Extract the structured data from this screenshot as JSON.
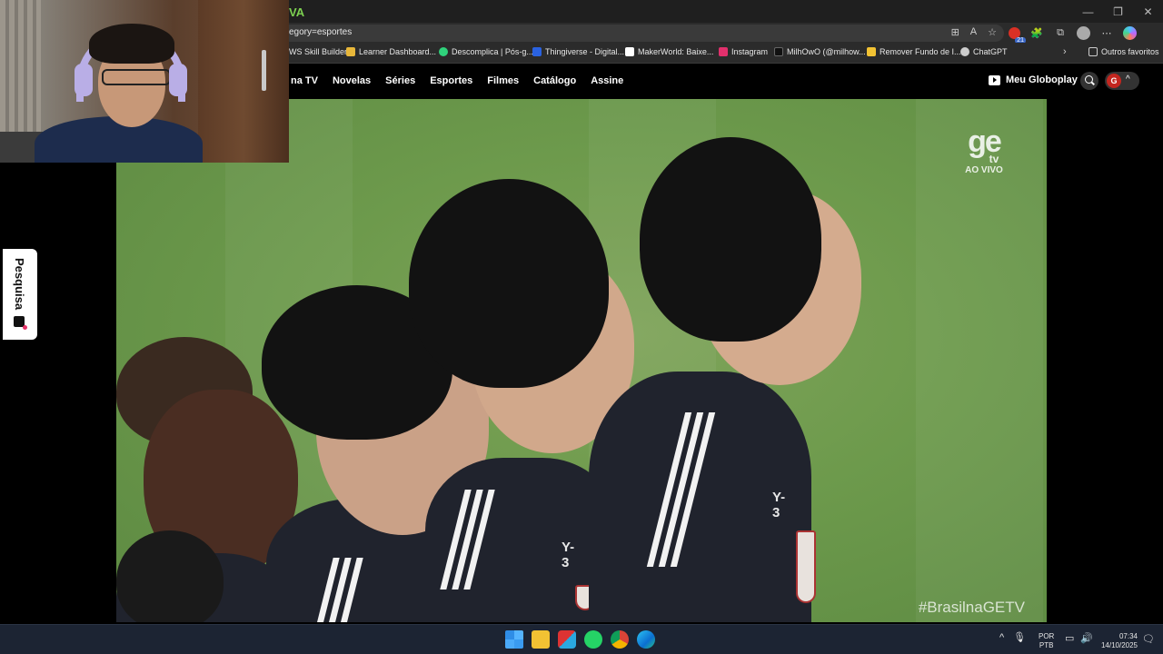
{
  "browser": {
    "tab_fragment": "VA",
    "address": "egory=esportes",
    "window_controls": [
      "—",
      "❐",
      "✕"
    ],
    "address_icons": [
      "⊞",
      "A",
      "☆"
    ],
    "toolbar_icons": [
      "🧩",
      "⧉",
      "⋯"
    ],
    "extension_badge": "21",
    "bookmarks": [
      {
        "label": "WS Skill Builder",
        "color": "#2b2b2b"
      },
      {
        "label": "Learner Dashboard...",
        "color": "#e8b73a"
      },
      {
        "label": "Descomplica | Pós-g...",
        "color": "#2fd27b"
      },
      {
        "label": "Thingiverse - Digital...",
        "color": "#2a62e0"
      },
      {
        "label": "MakerWorld: Baixe...",
        "color": "#ffffff"
      },
      {
        "label": "Instagram",
        "color": "#e1306c"
      },
      {
        "label": "MilhOwO (@milhow...",
        "color": "#111111"
      },
      {
        "label": "Remover Fundo de I...",
        "color": "#f2c233"
      },
      {
        "label": "ChatGPT",
        "color": "#cccccc"
      }
    ],
    "bookmarks_more": "›",
    "other_favorites": "Outros favoritos"
  },
  "globoplay": {
    "nav": [
      "na TV",
      "Novelas",
      "Séries",
      "Esportes",
      "Filmes",
      "Catálogo",
      "Assine"
    ],
    "meu_globoplay": "Meu Globoplay",
    "avatar_initial": "G",
    "account_chevron": "^"
  },
  "video": {
    "channel_logo": "ge",
    "channel_sub": "tv",
    "live_label": "AO VIVO",
    "hashtag": "#BrasilnaGETV",
    "jersey_text": "Y-3"
  },
  "side_tab": {
    "label": "Pesquisa"
  },
  "taskbar": {
    "language_line1": "POR",
    "language_line2": "PTB",
    "time": "07:34",
    "date": "14/10/2025",
    "tray_chevron": "^"
  }
}
